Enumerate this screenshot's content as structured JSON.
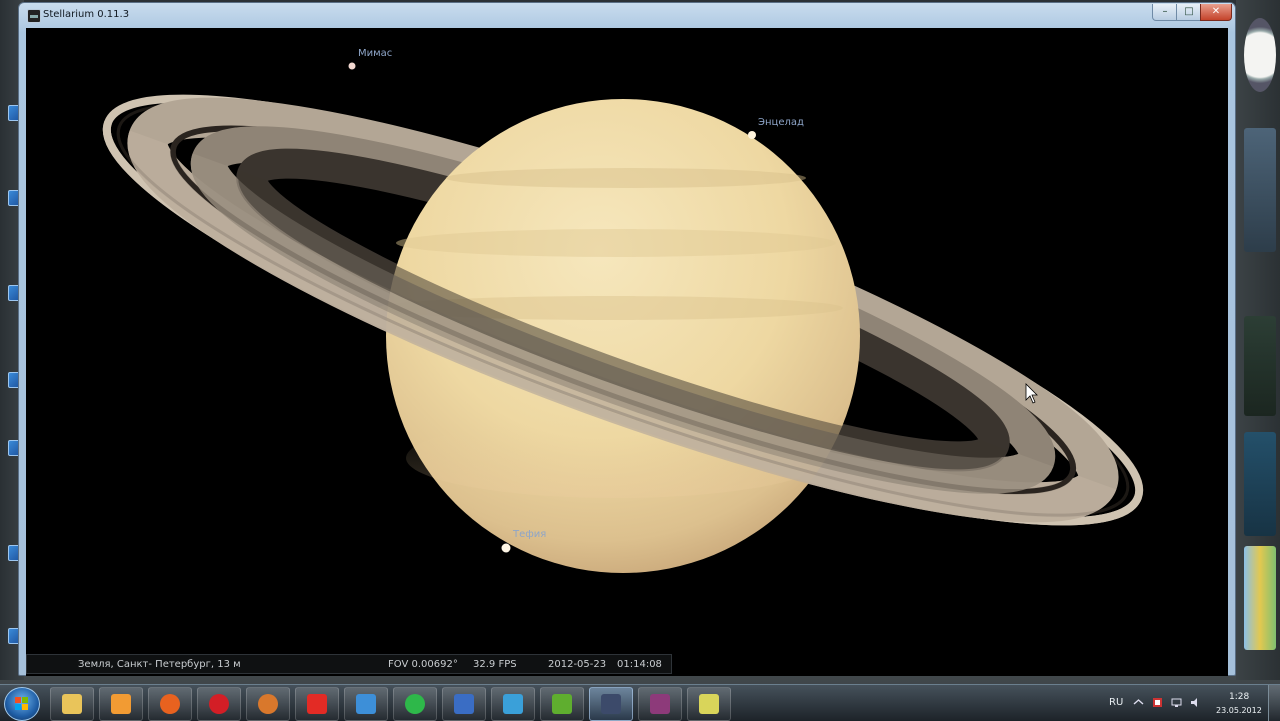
{
  "window": {
    "title": "Stellarium 0.11.3",
    "controls": {
      "minimize": "–",
      "maximize": "□",
      "close": "✕"
    }
  },
  "sky": {
    "moons": [
      {
        "name": "Мимас"
      },
      {
        "name": "Энцелад"
      },
      {
        "name": "Тефия"
      }
    ]
  },
  "status": {
    "location": "Земля, Санкт- Петербург, 13 м",
    "fov": "FOV 0.00692°",
    "fps": "32.9 FPS",
    "date": "2012-05-23",
    "time": "01:14:08"
  },
  "taskbar": {
    "apps": [
      {
        "icon": "folder-icon",
        "color": "#e9c45a"
      },
      {
        "icon": "media-player-icon",
        "color": "#f29b33"
      },
      {
        "icon": "firefox-icon",
        "color": "#e8621f"
      },
      {
        "icon": "opera-icon",
        "color": "#d31e26"
      },
      {
        "icon": "firefox-alt-icon",
        "color": "#d9782c"
      },
      {
        "icon": "yandex-icon",
        "color": "#e32b25"
      },
      {
        "icon": "mail-icon",
        "color": "#3d8fd8"
      },
      {
        "icon": "icq-at-icon",
        "color": "#2eb84a"
      },
      {
        "icon": "archive-icon",
        "color": "#3a6dc4"
      },
      {
        "icon": "torrent-icon",
        "color": "#3aa0d9"
      },
      {
        "icon": "download-icon",
        "color": "#5fae2f"
      },
      {
        "icon": "stellarium-icon",
        "color": "#3c4a6a"
      },
      {
        "icon": "winrar-icon",
        "color": "#8d3a7a"
      },
      {
        "icon": "notes-icon",
        "color": "#d9d55a"
      }
    ],
    "language": "RU",
    "clock_time": "1:28",
    "clock_date": "23.05.2012"
  },
  "colors": {
    "sky": "#000000",
    "planet_light": "#f2e2b4",
    "planet_shadow": "#c9a97a",
    "ring": "#b7aa99",
    "label": "#8ea5c8"
  }
}
